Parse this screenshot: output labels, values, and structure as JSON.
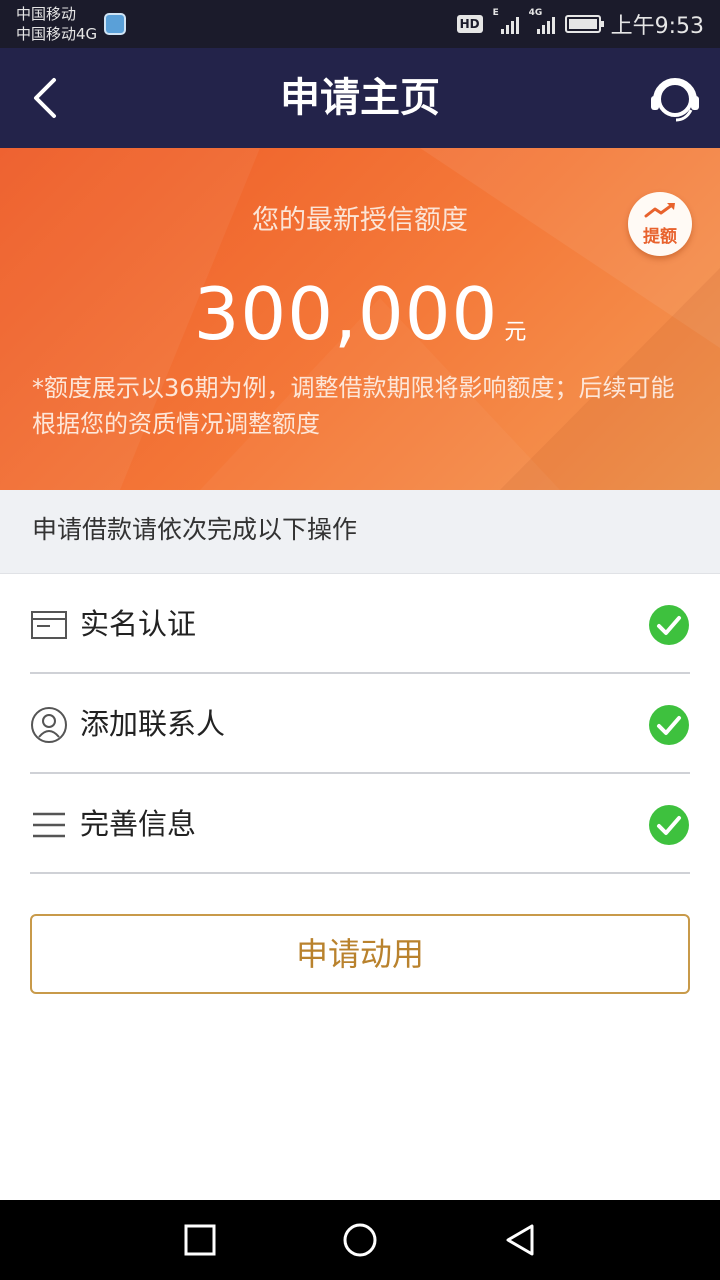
{
  "status_bar": {
    "carrier_1": "中国移动",
    "carrier_2": "中国移动4G",
    "hd": "HD",
    "network_1": "E",
    "network_2": "4G",
    "time": "上午9:53"
  },
  "nav": {
    "title": "申请主页",
    "back_icon": "chevron-left-icon",
    "service_icon": "headset-icon"
  },
  "hero": {
    "label": "您的最新授信额度",
    "amount": "300,000",
    "unit": "元",
    "raise_label": "提额",
    "note": "*额度展示以36期为例，调整借款期限将影响额度；后续可能根据您的资质情况调整额度",
    "colors": {
      "gradient_start": "#ee5a26",
      "gradient_end": "#f39a55"
    }
  },
  "steps": {
    "header": "申请借款请依次完成以下操作",
    "items": [
      {
        "label": "实名认证",
        "icon": "id-card-icon",
        "done": true
      },
      {
        "label": "添加联系人",
        "icon": "contact-icon",
        "done": true
      },
      {
        "label": "完善信息",
        "icon": "list-icon",
        "done": true
      }
    ],
    "check_color": "#3ec13e"
  },
  "action": {
    "apply_label": "申请动用",
    "accent": "#b9822d"
  },
  "system_nav": {
    "recent": "square-icon",
    "home": "circle-icon",
    "back": "triangle-back-icon"
  }
}
